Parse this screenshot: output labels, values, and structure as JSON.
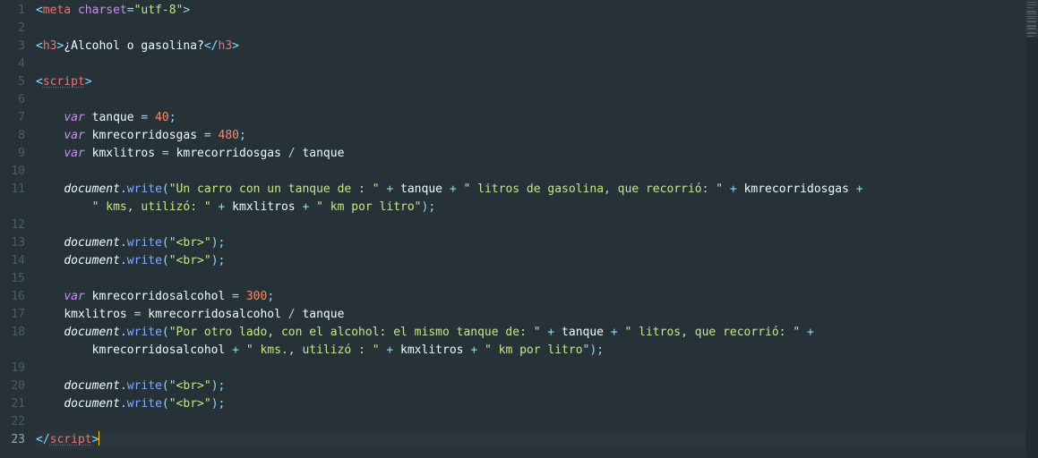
{
  "editor": {
    "line_count": 23,
    "active_line": 23,
    "lines": [
      {
        "n": 1,
        "html": "<span class='punct'>&lt;</span><span class='tag'>meta</span> <span class='attr'>charset</span><span class='op'>=</span><span class='str'>\"utf-8\"</span><span class='punct'>&gt;</span>"
      },
      {
        "n": 2,
        "html": ""
      },
      {
        "n": 3,
        "html": "<span class='punct'>&lt;</span><span class='tag'>h3</span><span class='punct'>&gt;</span>¿Alcohol o gasolina?<span class='punct'>&lt;/</span><span class='tag'>h3</span><span class='punct'>&gt;</span>"
      },
      {
        "n": 4,
        "html": ""
      },
      {
        "n": 5,
        "html": "<span class='punct'>&lt;</span><span class='tag und'>script</span><span class='punct'>&gt;</span>"
      },
      {
        "n": 6,
        "html": ""
      },
      {
        "n": 7,
        "html": "    <span class='kw'>var</span> <span class='ident'>tanque</span> <span class='op'>=</span> <span class='num'>40</span><span class='punct'>;</span>"
      },
      {
        "n": 8,
        "html": "    <span class='kw'>var</span> <span class='ident'>kmrecorridosgas</span> <span class='op'>=</span> <span class='num'>480</span><span class='punct'>;</span>"
      },
      {
        "n": 9,
        "html": "    <span class='kw'>var</span> <span class='ident'>kmxlitros</span> <span class='op'>=</span> <span class='ident'>kmrecorridosgas</span> <span class='op'>/</span> <span class='ident'>tanque</span>"
      },
      {
        "n": 10,
        "html": ""
      },
      {
        "n": 11,
        "html": "    <span class='obj'>document</span><span class='punct'>.</span><span class='func'>write</span><span class='punct'>(</span><span class='str'>\"Un carro con un tanque de : \"</span> <span class='op'>+</span> <span class='ident'>tanque</span> <span class='op'>+</span> <span class='str'>\" litros de gasolina, que recorrió: \"</span> <span class='op'>+</span> <span class='ident'>kmrecorridosgas</span> <span class='op'>+</span>"
      },
      {
        "n": -1,
        "html": "        <span class='str'>\" kms, utilizó: \"</span> <span class='op'>+</span> <span class='ident'>kmxlitros</span> <span class='op'>+</span> <span class='str'>\" km por litro\"</span><span class='punct'>);</span>"
      },
      {
        "n": 12,
        "html": ""
      },
      {
        "n": 13,
        "html": "    <span class='obj'>document</span><span class='punct'>.</span><span class='func'>write</span><span class='punct'>(</span><span class='str'>\"&lt;br&gt;\"</span><span class='punct'>);</span>"
      },
      {
        "n": 14,
        "html": "    <span class='obj'>document</span><span class='punct'>.</span><span class='func'>write</span><span class='punct'>(</span><span class='str'>\"&lt;br&gt;\"</span><span class='punct'>);</span>"
      },
      {
        "n": 15,
        "html": ""
      },
      {
        "n": 16,
        "html": "    <span class='kw'>var</span> <span class='ident'>kmrecorridosalcohol</span> <span class='op'>=</span> <span class='num'>300</span><span class='punct'>;</span>"
      },
      {
        "n": 17,
        "html": "    <span class='ident'>kmxlitros</span> <span class='op'>=</span> <span class='ident'>kmrecorridosalcohol</span> <span class='op'>/</span> <span class='ident'>tanque</span>"
      },
      {
        "n": 18,
        "html": "    <span class='obj'>document</span><span class='punct'>.</span><span class='func'>write</span><span class='punct'>(</span><span class='str'>\"Por otro lado, con el alcohol: el mismo tanque de: \"</span> <span class='op'>+</span> <span class='ident'>tanque</span> <span class='op'>+</span> <span class='str'>\" litros, que recorrió: \"</span> <span class='op'>+</span>"
      },
      {
        "n": -1,
        "html": "        <span class='ident'>kmrecorridosalcohol</span> <span class='op'>+</span> <span class='str'>\" kms., utilizó : \"</span> <span class='op'>+</span> <span class='ident'>kmxlitros</span> <span class='op'>+</span> <span class='str'>\" km por litro\"</span><span class='punct'>);</span>"
      },
      {
        "n": 19,
        "html": ""
      },
      {
        "n": 20,
        "html": "    <span class='obj'>document</span><span class='punct'>.</span><span class='func'>write</span><span class='punct'>(</span><span class='str'>\"&lt;br&gt;\"</span><span class='punct'>);</span>"
      },
      {
        "n": 21,
        "html": "    <span class='obj'>document</span><span class='punct'>.</span><span class='func'>write</span><span class='punct'>(</span><span class='str'>\"&lt;br&gt;\"</span><span class='punct'>);</span>"
      },
      {
        "n": 22,
        "html": ""
      },
      {
        "n": 23,
        "html": "<span class='punct'>&lt;/</span><span class='tag und'>script</span><span class='punct'>&gt;</span><span class='cursor'></span>"
      }
    ]
  }
}
